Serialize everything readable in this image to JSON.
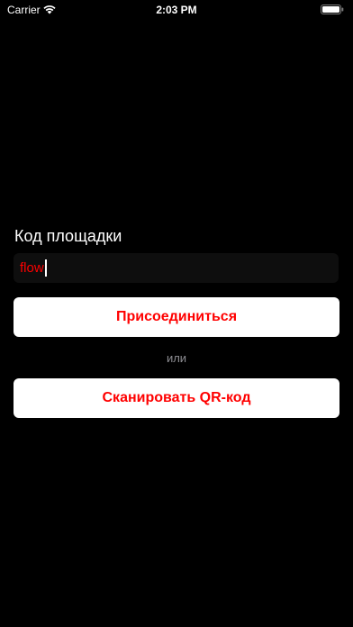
{
  "status_bar": {
    "carrier": "Carrier",
    "time": "2:03 PM",
    "icons": [
      "wifi-icon",
      "battery-icon"
    ]
  },
  "form": {
    "label": "Код площадки",
    "input_value": "flow"
  },
  "buttons": {
    "join_label": "Присоединиться",
    "or_label": "или",
    "scan_label": "Сканировать QR-код"
  },
  "colors": {
    "background": "#000000",
    "accent": "#ff0000",
    "button_bg": "#ffffff",
    "secondary_text": "#8e8e93"
  }
}
